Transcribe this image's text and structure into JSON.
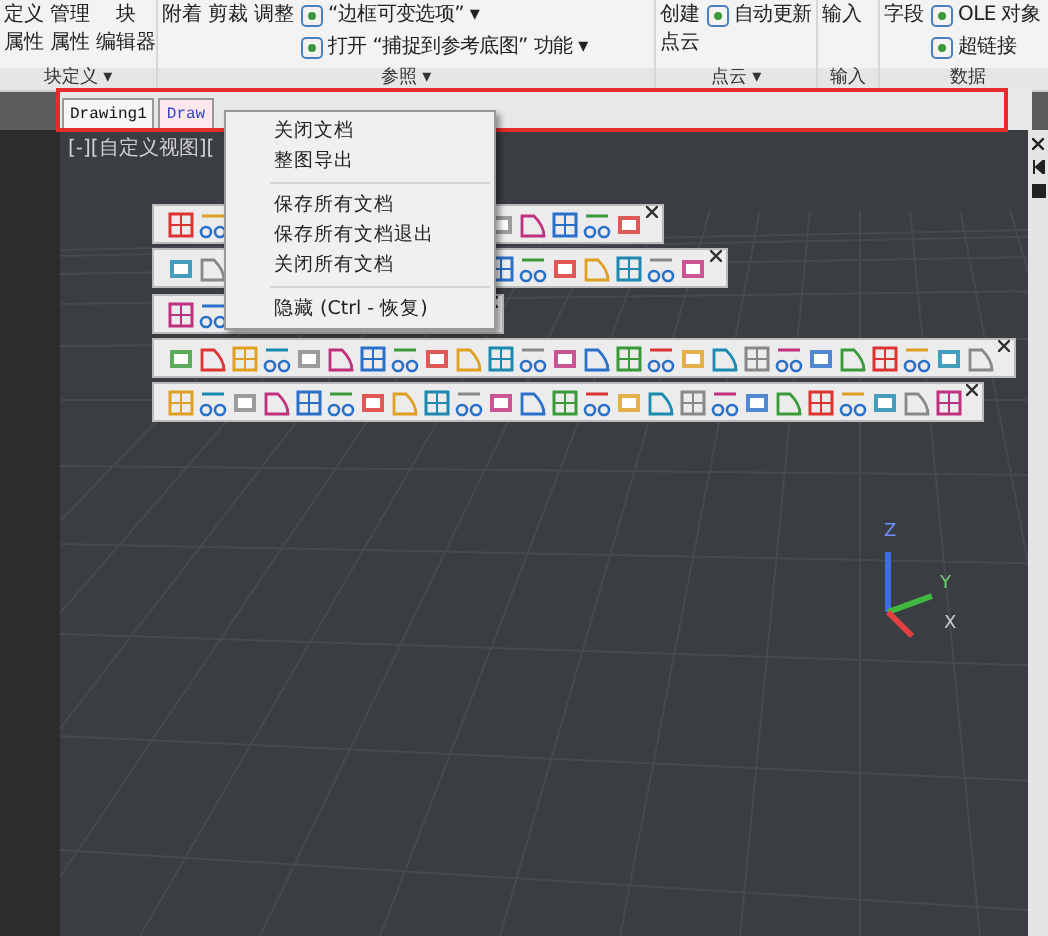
{
  "ribbon": {
    "panels": [
      {
        "buttons": [
          {
            "top": "定义",
            "bottom": "属性"
          },
          {
            "top": "管理",
            "bottom": "属性"
          },
          {
            "top": "块",
            "bottom": "编辑器"
          }
        ],
        "title": "块定义 ▾"
      },
      {
        "buttons": [
          {
            "top": "附着"
          },
          {
            "top": "剪裁"
          },
          {
            "top": "调整"
          }
        ],
        "rows": [
          "“边框可变选项” ▾",
          "打开 “捕捉到参考底图” 功能 ▾"
        ],
        "title": "参照 ▾"
      },
      {
        "buttons": [
          {
            "top": "创建",
            "bottom": "点云"
          }
        ],
        "rows": [
          "自动更新"
        ],
        "title": "点云 ▾"
      },
      {
        "buttons": [
          {
            "top": "输入"
          }
        ],
        "title": "输入"
      },
      {
        "buttons": [
          {
            "top": "字段"
          }
        ],
        "rows": [
          "OLE 对象",
          "超链接"
        ],
        "title": "数据"
      }
    ]
  },
  "doc_tabs": [
    {
      "label": "Drawing1",
      "selected": true
    },
    {
      "label": "Draw",
      "selected": false
    }
  ],
  "viewport": {
    "label": "[-][自定义视图][",
    "axes": [
      "Z",
      "Y",
      "X"
    ]
  },
  "context_menu": {
    "groups": [
      [
        "关闭文档",
        "整图导出"
      ],
      [
        "保存所有文档",
        "保存所有文档退出",
        "关闭所有文档"
      ],
      [
        "隐藏 (Ctrl - 恢复)"
      ]
    ]
  }
}
